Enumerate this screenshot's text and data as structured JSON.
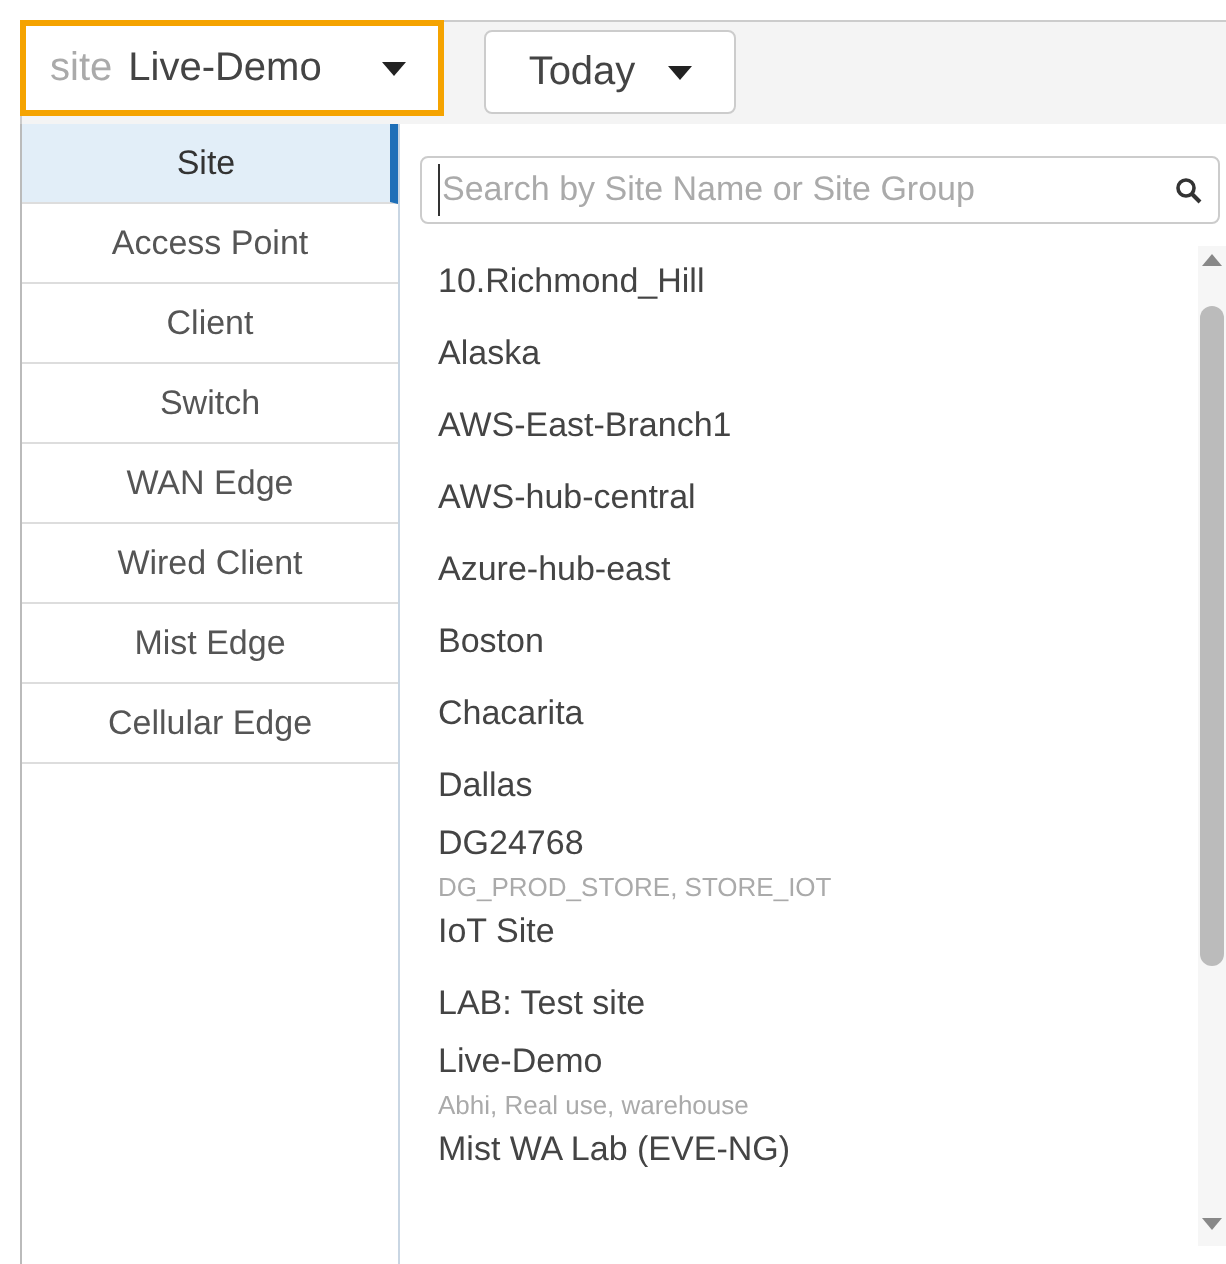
{
  "site_selector": {
    "label": "site",
    "value": "Live-Demo",
    "focused": true
  },
  "date_selector": {
    "value": "Today"
  },
  "categories": [
    {
      "label": "Site",
      "selected": true
    },
    {
      "label": "Access Point",
      "selected": false
    },
    {
      "label": "Client",
      "selected": false
    },
    {
      "label": "Switch",
      "selected": false
    },
    {
      "label": "WAN Edge",
      "selected": false
    },
    {
      "label": "Wired Client",
      "selected": false
    },
    {
      "label": "Mist Edge",
      "selected": false
    },
    {
      "label": "Cellular Edge",
      "selected": false
    }
  ],
  "search": {
    "placeholder": "Search by Site Name or Site Group"
  },
  "sites": [
    {
      "name": "10.Richmond_Hill"
    },
    {
      "name": "Alaska"
    },
    {
      "name": "AWS-East-Branch1"
    },
    {
      "name": "AWS-hub-central"
    },
    {
      "name": "Azure-hub-east"
    },
    {
      "name": "Boston"
    },
    {
      "name": "Chacarita"
    },
    {
      "name": "Dallas"
    },
    {
      "name": "DG24768",
      "groups": "DG_PROD_STORE, STORE_IOT"
    },
    {
      "name": "IoT Site"
    },
    {
      "name": "LAB: Test site"
    },
    {
      "name": "Live-Demo",
      "groups": "Abhi, Real use, warehouse"
    },
    {
      "name": "Mist WA Lab (EVE-NG)"
    }
  ]
}
